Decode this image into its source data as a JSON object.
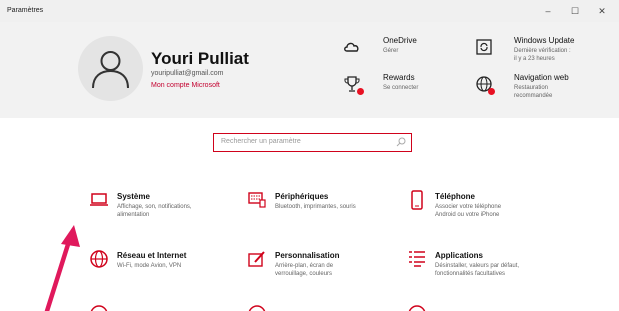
{
  "window": {
    "title": "Paramètres",
    "min": "–",
    "max": "☐",
    "close": "✕"
  },
  "user": {
    "name": "Youri Pulliat",
    "email": "youripulliat@gmail.com",
    "account_link": "Mon compte Microsoft"
  },
  "quick": [
    {
      "title": "OneDrive",
      "sub1": "Gérer",
      "sub2": "",
      "icon": "cloud-icon"
    },
    {
      "title": "Windows Update",
      "sub1": "Dernière vérification :",
      "sub2": "il y a 23 heures",
      "icon": "refresh-icon"
    },
    {
      "title": "Rewards",
      "sub1": "Se connecter",
      "sub2": "",
      "icon": "trophy-icon"
    },
    {
      "title": "Navigation web",
      "sub1": "Restauration",
      "sub2": "recommandée",
      "icon": "globe-icon"
    }
  ],
  "search": {
    "placeholder": "Rechercher un paramètre"
  },
  "categories": [
    {
      "title": "Système",
      "desc1": "Affichage, son, notifications,",
      "desc2": "alimentation",
      "icon": "laptop-icon"
    },
    {
      "title": "Périphériques",
      "desc1": "Bluetooth, imprimantes, souris",
      "desc2": "",
      "icon": "keyboard-icon"
    },
    {
      "title": "Téléphone",
      "desc1": "Associer votre téléphone",
      "desc2": "Android ou votre iPhone",
      "icon": "phone-icon"
    },
    {
      "title": "Réseau et Internet",
      "desc1": "Wi-Fi, mode Avion, VPN",
      "desc2": "",
      "icon": "globe-icon"
    },
    {
      "title": "Personnalisation",
      "desc1": "Arrière-plan, écran de",
      "desc2": "verrouillage, couleurs",
      "icon": "paint-icon"
    },
    {
      "title": "Applications",
      "desc1": "Désinstaller, valeurs par défaut,",
      "desc2": "fonctionnalités facultatives",
      "icon": "apps-list-icon"
    }
  ],
  "colors": {
    "accent": "#c3002f",
    "arrow": "#e0195c",
    "icon_red": "#d0021b",
    "background": "#2b2b2b"
  }
}
